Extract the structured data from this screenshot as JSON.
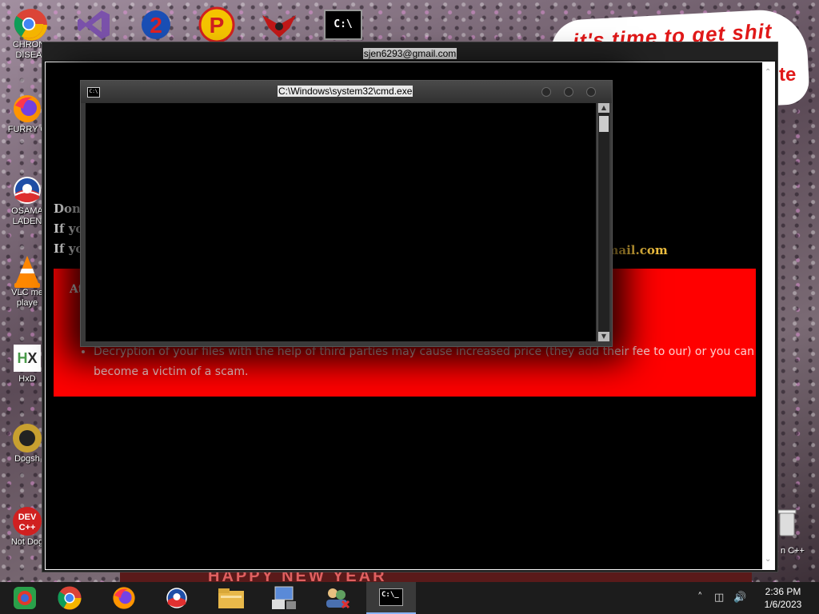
{
  "desktop": {
    "icons": [
      {
        "label": "CHRON\nDISEA",
        "icon": "chrome-icon"
      },
      {
        "label": "FURRY C",
        "icon": "firefox-icon"
      },
      {
        "label": "OSAMA\nLADEN",
        "icon": "obama-logo-icon"
      },
      {
        "label": "VLC me\nplaye",
        "icon": "vlc-icon"
      },
      {
        "label": "HxD",
        "icon": "hxd-icon"
      },
      {
        "label": "Dogsh",
        "icon": "dog-icon"
      },
      {
        "label": "Not Dog",
        "icon": "devcpp-icon"
      }
    ],
    "top_icons": [
      "chrome-icon",
      "visual-studio-icon",
      "sonic-2-icon",
      "p-icon",
      "bird-logo-icon",
      "cmd-icon"
    ],
    "right_label": "n C++",
    "wallpaper_text": "it's time to get shit",
    "wallpaper_text2": "te",
    "banner_text": "HAPPY NEW YEAR"
  },
  "ransom_window": {
    "title": "sjen6293@gmail.com",
    "line1": "Don'",
    "line2": "If yo",
    "line3": "If yo",
    "email_tail": "gmail.com",
    "attention_prefix": "At",
    "bullet": "Decryption of your files with the help of third parties may cause increased price (they add their fee to our) or you can become a victim of a scam."
  },
  "cmd_window": {
    "title": "C:\\Windows\\system32\\cmd.exe",
    "icon_text": "C:\\"
  },
  "taskbar": {
    "apps": [
      "chrome-colorful-icon",
      "chrome-icon",
      "firefox-icon",
      "obama-logo-icon",
      "file-explorer-icon",
      "control-panel-icon",
      "network-people-icon",
      "cmd-icon"
    ],
    "time": "2:36 PM",
    "date": "1/6/2023",
    "colors": {
      "accent": "#8ab4f8",
      "taskbar": "#1c1c1c"
    }
  },
  "colors": {
    "ransom_red": "#ff0000",
    "email_gold": "#f0c040"
  }
}
